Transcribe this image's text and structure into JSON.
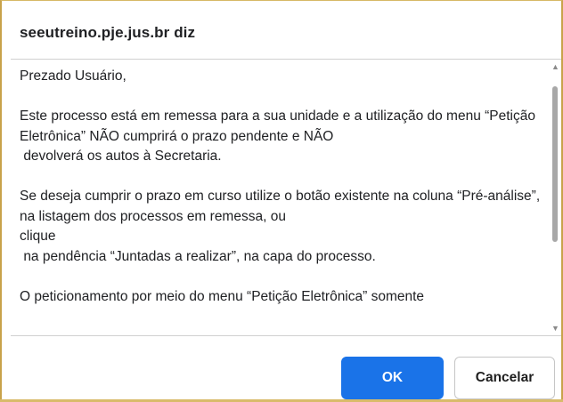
{
  "dialog": {
    "title": "seeutreino.pje.jus.br diz",
    "message": "Prezado Usuário,\n\nEste processo está em remessa para a sua unidade e a utilização do menu “Petição Eletrônica” NÃO cumprirá o prazo pendente e NÃO\n devolverá os autos à Secretaria.\n\nSe deseja cumprir o prazo em curso utilize o botão existente na coluna “Pré-análise”, na listagem dos processos em remessa, ou\nclique\n na pendência “Juntadas a realizar”, na capa do processo.\n\nO peticionamento por meio do menu “Petição Eletrônica” somente",
    "ok_label": "OK",
    "cancel_label": "Cancelar"
  },
  "colors": {
    "accent": "#1a73e8",
    "window_border": "#c8a24a"
  },
  "icons": {
    "scroll_up": "chevron-up-icon",
    "scroll_down": "chevron-down-icon"
  }
}
